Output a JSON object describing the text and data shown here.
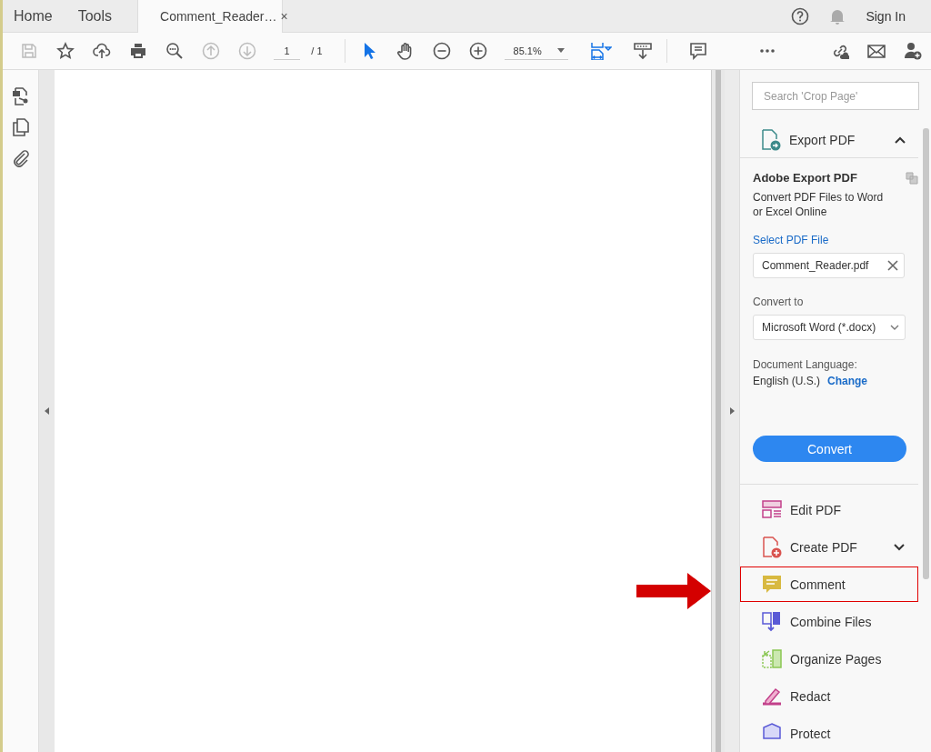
{
  "tabs": [
    {
      "label": "Home",
      "selected": false
    },
    {
      "label": "Tools",
      "selected": false
    },
    {
      "label": "Comment_Reader…",
      "selected": true,
      "close": "×"
    }
  ],
  "header": {
    "sign_in": "Sign In"
  },
  "toolbar": {
    "page_number": "1",
    "page_total": "/ 1",
    "zoom": "85.1%"
  },
  "search": {
    "placeholder": "Search 'Crop Page'"
  },
  "export_panel": {
    "title": "Export PDF",
    "expanded": true,
    "heading": "Adobe Export PDF",
    "description": "Convert PDF Files to Word or Excel Online",
    "select_link": "Select PDF File",
    "file": "Comment_Reader.pdf",
    "convert_to_label": "Convert to",
    "format": "Microsoft Word (*.docx)",
    "language_label": "Document Language:",
    "language": "English (U.S.)",
    "change_link": "Change",
    "button": "Convert"
  },
  "tools": [
    {
      "label": "Edit PDF",
      "kind": "edit",
      "expandable": false,
      "highlighted": false
    },
    {
      "label": "Create PDF",
      "kind": "create",
      "expandable": true,
      "highlighted": false
    },
    {
      "label": "Comment",
      "kind": "comment",
      "expandable": false,
      "highlighted": true
    },
    {
      "label": "Combine Files",
      "kind": "combine",
      "expandable": false,
      "highlighted": false
    },
    {
      "label": "Organize Pages",
      "kind": "organize",
      "expandable": false,
      "highlighted": false
    },
    {
      "label": "Redact",
      "kind": "redact",
      "expandable": false,
      "highlighted": false
    },
    {
      "label": "Protect",
      "kind": "protect",
      "expandable": false,
      "highlighted": false
    }
  ]
}
